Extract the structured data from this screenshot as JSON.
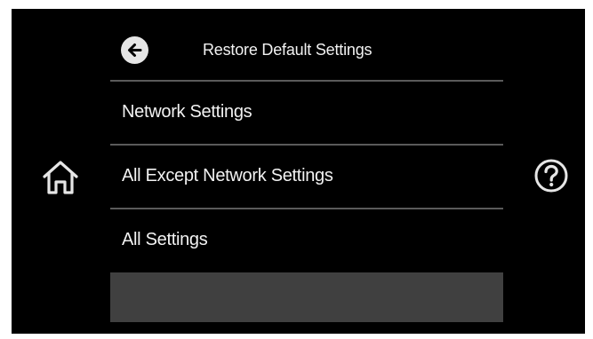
{
  "header": {
    "title": "Restore Default Settings",
    "back_icon": "back-arrow-icon"
  },
  "menu": {
    "items": [
      {
        "label": "Network Settings"
      },
      {
        "label": "All Except Network Settings"
      },
      {
        "label": "All Settings"
      }
    ]
  },
  "side": {
    "home_icon": "home-icon",
    "help_icon": "help-icon"
  },
  "colors": {
    "screen_background": "#000000",
    "text": "#f2f2f2",
    "divider": "#5a5a5a",
    "empty_row": "#404040",
    "icon": "#e6e6e6"
  }
}
